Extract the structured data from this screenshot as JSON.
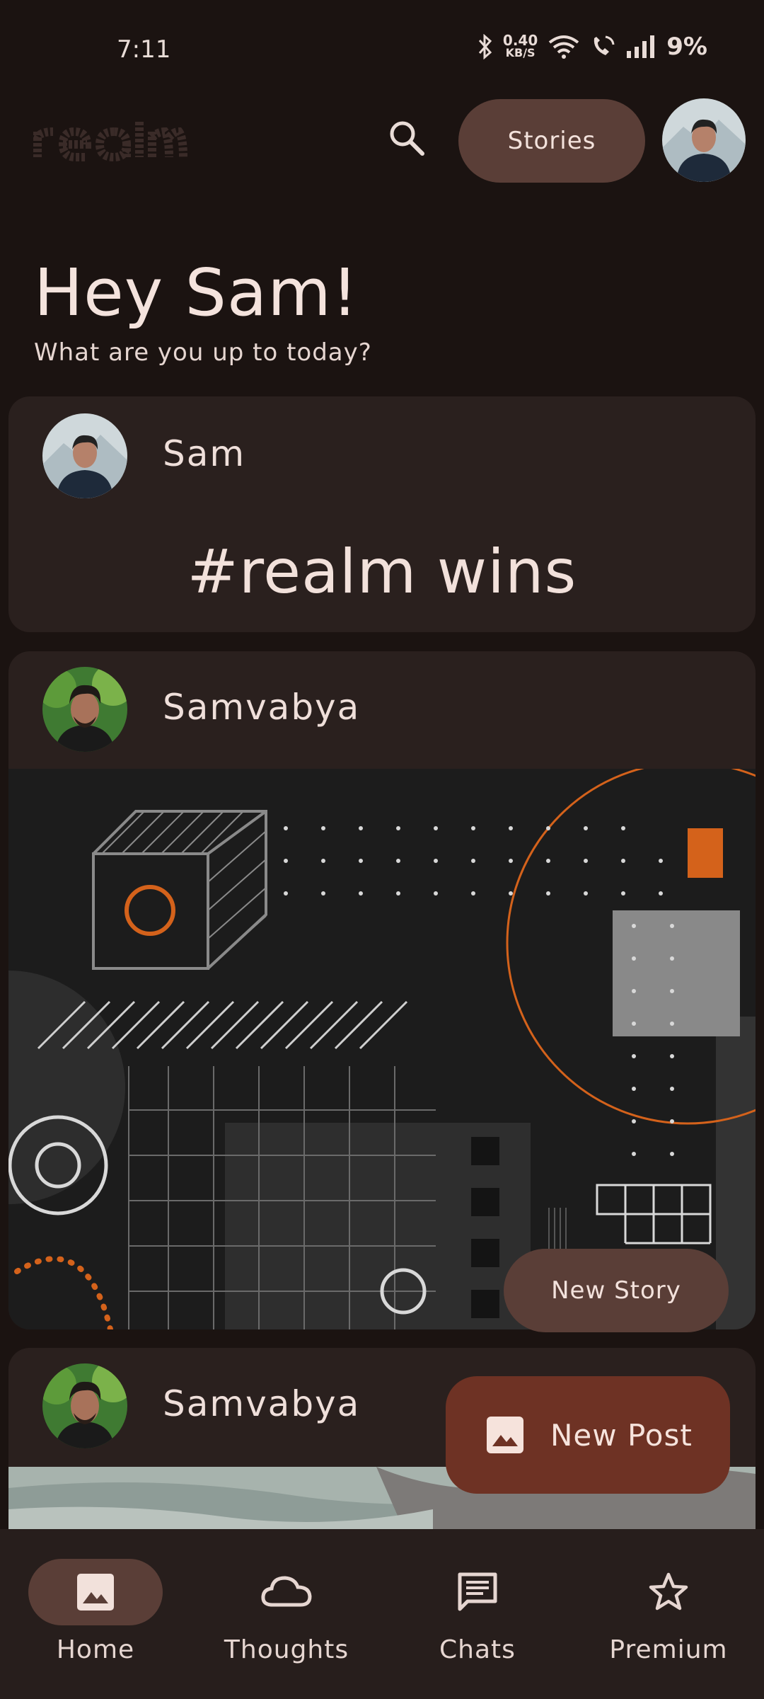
{
  "status": {
    "time": "7:11",
    "net_speed_value": "0.40",
    "net_speed_unit": "KB/S",
    "battery": "9%"
  },
  "header": {
    "logo_text": "realm",
    "stories_label": "Stories"
  },
  "greeting": {
    "title": "Hey Sam!",
    "subtitle": "What are you up to today?"
  },
  "posts": [
    {
      "author": "Sam",
      "text": "#realm wins"
    },
    {
      "author": "Samvabya"
    },
    {
      "author": "Samvabya"
    }
  ],
  "actions": {
    "new_story": "New Story",
    "new_post": "New Post"
  },
  "nav": [
    {
      "label": "Home",
      "icon": "image-icon",
      "active": true
    },
    {
      "label": "Thoughts",
      "icon": "cloud-icon",
      "active": false
    },
    {
      "label": "Chats",
      "icon": "chat-icon",
      "active": false
    },
    {
      "label": "Premium",
      "icon": "star-icon",
      "active": false
    }
  ],
  "colors": {
    "background": "#1b1311",
    "card": "#2a201e",
    "accent_pill": "#5a3e37",
    "fab": "#6e3224",
    "orange": "#d4621b"
  }
}
